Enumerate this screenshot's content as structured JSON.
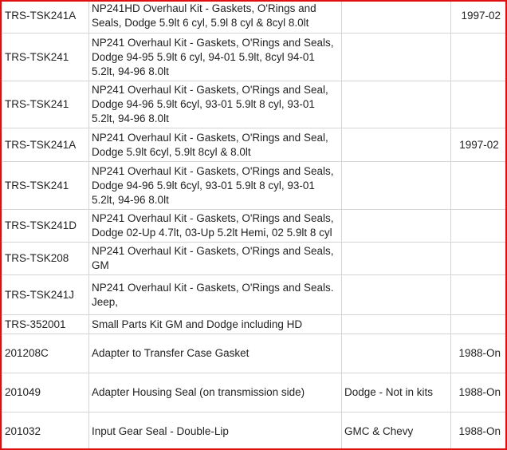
{
  "rows": [
    {
      "part": "TRS-TSK241A",
      "desc": "NP241HD Overhaul Kit - Gaskets, O'Rings and Seals, Dodge 5.9lt 6 cyl, 5.9l 8 cyl & 8cyl 8.0lt",
      "app": "",
      "year": "1997-02"
    },
    {
      "part": "TRS-TSK241",
      "desc": "NP241 Overhaul Kit - Gaskets, O'Rings and Seals, Dodge 94-95 5.9lt 6 cyl, 94-01 5.9lt, 8cyl 94-01 5.2lt, 94-96 8.0lt",
      "app": "",
      "year": ""
    },
    {
      "part": "TRS-TSK241",
      "desc": "NP241 Overhaul Kit - Gaskets, O'Rings and Seal, Dodge 94-96 5.9lt 6cyl,  93-01 5.9lt 8 cyl, 93-01 5.2lt, 94-96 8.0lt",
      "app": "",
      "year": ""
    },
    {
      "part": "TRS-TSK241A",
      "desc": "NP241 Overhaul Kit - Gaskets, O'Rings and Seal, Dodge 5.9lt 6cyl, 5.9lt 8cyl & 8.0lt",
      "app": "",
      "year": "1997-02"
    },
    {
      "part": "TRS-TSK241",
      "desc": "NP241 Overhaul Kit - Gaskets, O'Rings and Seals, Dodge 94-96 5.9lt 6cyl,  93-01 5.9lt 8 cyl, 93-01 5.2lt, 94-96 8.0lt",
      "app": "",
      "year": ""
    },
    {
      "part": "TRS-TSK241D",
      "desc": "NP241 Overhaul Kit - Gaskets, O'Rings and Seals, Dodge 02-Up 4.7lt, 03-Up 5.2lt Hemi, 02 5.9lt 8 cyl",
      "app": "",
      "year": ""
    },
    {
      "part": "TRS-TSK208",
      "desc": "NP241 Overhaul Kit - Gaskets, O'Rings and Seals, GM",
      "app": "",
      "year": ""
    },
    {
      "part": "TRS-TSK241J",
      "desc": "NP241 Overhaul Kit - Gaskets, O'Rings and Seals. Jeep,",
      "app": "",
      "year": ""
    },
    {
      "part": "TRS-352001",
      "desc": "Small Parts Kit GM and Dodge including HD",
      "app": "",
      "year": ""
    },
    {
      "part": "201208C",
      "desc": "Adapter to Transfer Case Gasket",
      "app": "",
      "year": "1988-On"
    },
    {
      "part": "201049",
      "desc": "Adapter Housing Seal (on transmission side)",
      "app": "Dodge - Not in kits",
      "year": "1988-On"
    },
    {
      "part": "201032",
      "desc": "Input Gear Seal - Double-Lip",
      "app": "GMC & Chevy",
      "year": "1988-On"
    }
  ],
  "frame_color": "#e01010"
}
